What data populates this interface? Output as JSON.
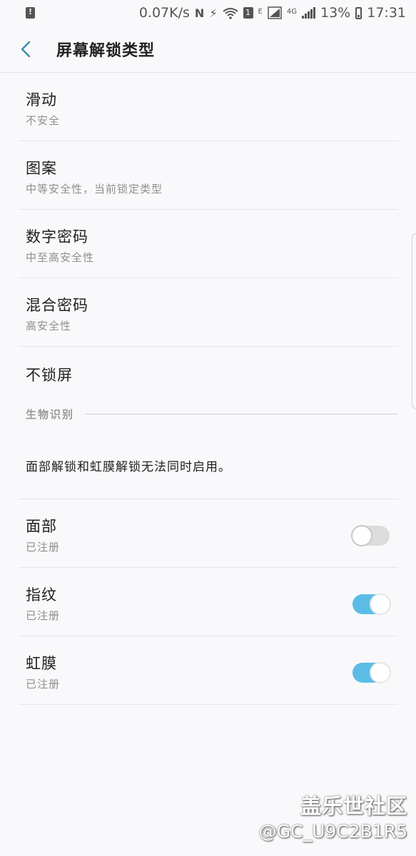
{
  "status_bar": {
    "speed": "0.07K/s",
    "battery_pct": "13%",
    "time": "17:31",
    "net_label": "4G",
    "e_label": "E",
    "sim_label": "1",
    "icons": [
      "alert-icon",
      "nfc-icon",
      "data-saver-icon",
      "wifi-icon",
      "sim-icon",
      "signal-icon",
      "battery-icon"
    ]
  },
  "header": {
    "title": "屏幕解锁类型",
    "back_icon": "chevron-left-icon",
    "accent": "#3d8fb0"
  },
  "lock_types": [
    {
      "title": "滑动",
      "subtitle": "不安全"
    },
    {
      "title": "图案",
      "subtitle": "中等安全性，当前锁定类型"
    },
    {
      "title": "数字密码",
      "subtitle": "中至高安全性"
    },
    {
      "title": "混合密码",
      "subtitle": "高安全性"
    },
    {
      "title": "不锁屏"
    }
  ],
  "biometrics": {
    "section_label": "生物识别",
    "info": "面部解锁和虹膜解锁无法同时启用。",
    "items": [
      {
        "title": "面部",
        "subtitle": "已注册",
        "enabled": false
      },
      {
        "title": "指纹",
        "subtitle": "已注册",
        "enabled": true
      },
      {
        "title": "虹膜",
        "subtitle": "已注册",
        "enabled": true
      }
    ]
  },
  "colors": {
    "toggle_on": "#5bbde6",
    "toggle_off": "#dcdcdd"
  },
  "watermark": {
    "brand": "盖乐世社区",
    "user": "@GC_U9C2B1R5"
  }
}
